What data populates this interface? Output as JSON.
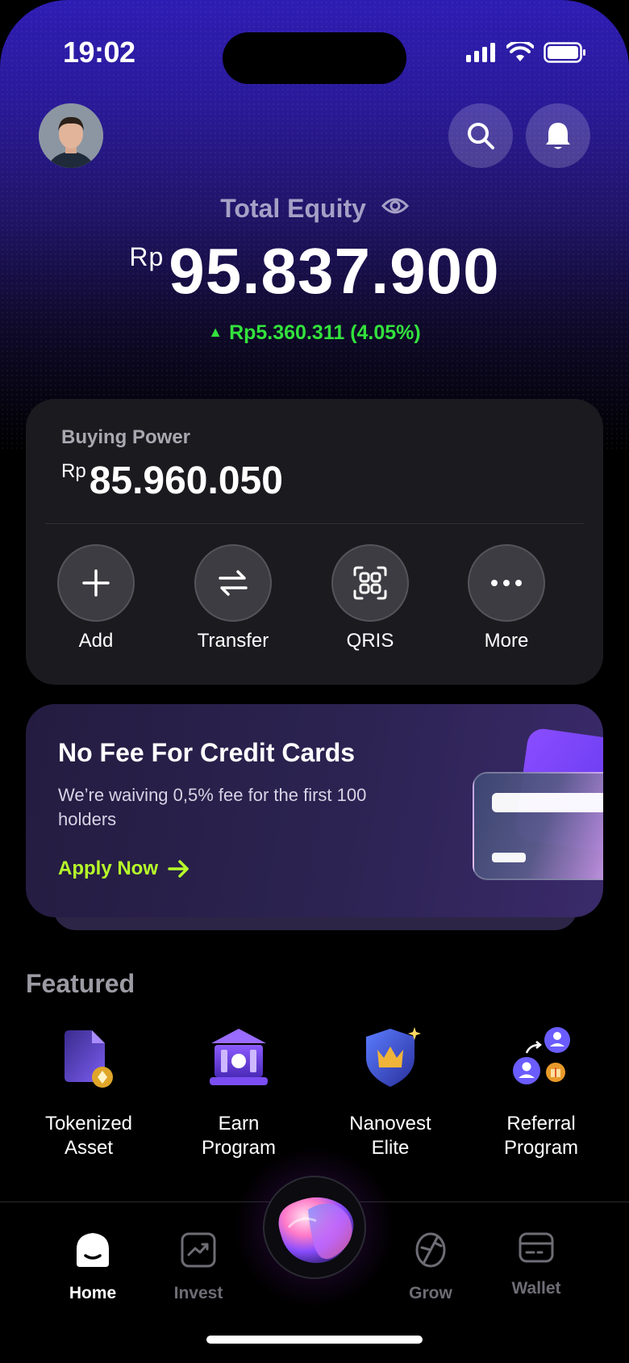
{
  "status_bar": {
    "time": "19:02"
  },
  "header": {
    "avatar_icon": "user-avatar",
    "search_icon": "search-icon",
    "notification_icon": "bell-icon"
  },
  "equity": {
    "label": "Total Equity",
    "currency": "Rp",
    "amount": "95.837.900",
    "change": "Rp5.360.311 (4.05%)",
    "change_direction": "up",
    "change_color": "#33e23c"
  },
  "buying_power": {
    "label": "Buying Power",
    "currency": "Rp",
    "amount": "85.960.050",
    "actions": [
      {
        "label": "Add",
        "icon": "plus-icon"
      },
      {
        "label": "Transfer",
        "icon": "transfer-icon"
      },
      {
        "label": "QRIS",
        "icon": "qris-icon"
      },
      {
        "label": "More",
        "icon": "more-icon"
      }
    ]
  },
  "promo": {
    "title": "No Fee For Credit Cards",
    "description": "We’re waiving 0,5% fee for the first 100 holders",
    "cta": "Apply Now",
    "cta_color": "#b7ff2a"
  },
  "featured": {
    "title": "Featured",
    "items": [
      {
        "line1": "Tokenized",
        "line2": "Asset",
        "icon": "tokenized-asset-icon"
      },
      {
        "line1": "Earn",
        "line2": "Program",
        "icon": "earn-program-icon"
      },
      {
        "line1": "Nanovest",
        "line2": "Elite",
        "icon": "elite-shield-icon"
      },
      {
        "line1": "Referral",
        "line2": "Program",
        "icon": "referral-icon"
      }
    ]
  },
  "bottom_nav": {
    "items": [
      {
        "label": "Home",
        "icon": "home-icon",
        "active": true
      },
      {
        "label": "Invest",
        "icon": "invest-icon",
        "active": false
      },
      {
        "label": "Grow",
        "icon": "grow-icon",
        "active": false
      },
      {
        "label": "Wallet",
        "icon": "wallet-icon",
        "active": false
      }
    ],
    "center_icon": "assistant-orb-icon"
  }
}
